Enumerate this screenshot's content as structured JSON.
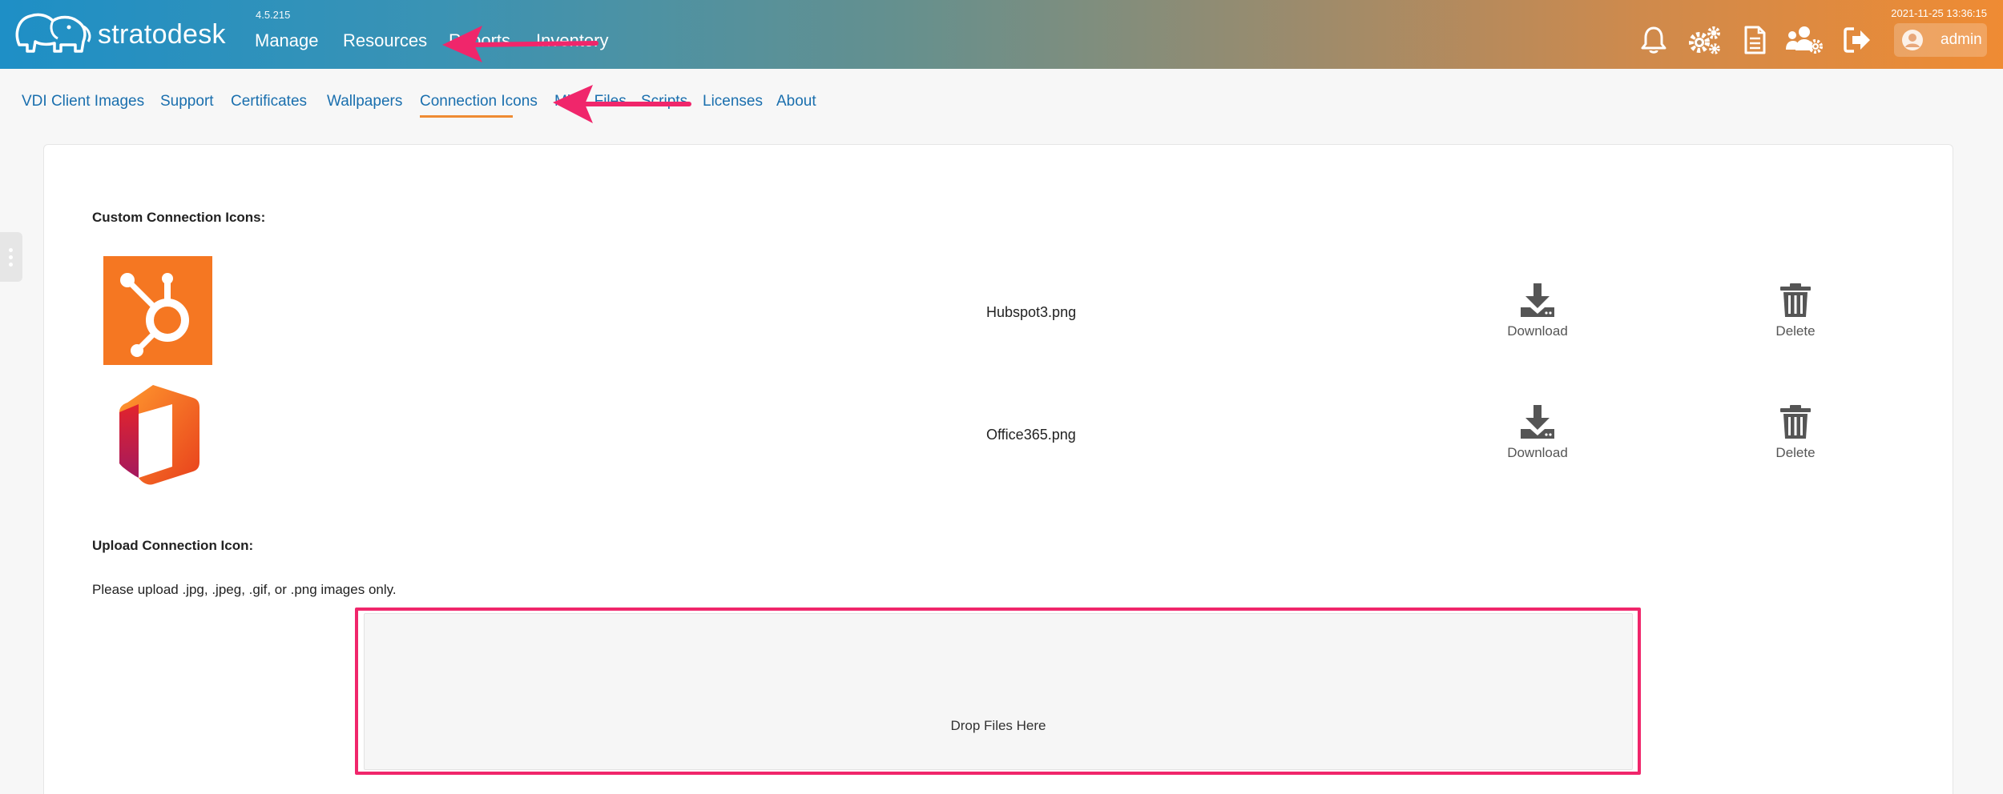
{
  "header": {
    "brand": "stratodesk",
    "version": "4.5.215",
    "nav": [
      {
        "label": "Manage"
      },
      {
        "label": "Resources"
      },
      {
        "label": "Reports"
      },
      {
        "label": "Inventory"
      }
    ],
    "timestamp": "2021-11-25 13:36:15",
    "user": "admin",
    "icons": [
      "bell-icon",
      "gears-icon",
      "document-icon",
      "users-gear-icon",
      "logout-icon"
    ]
  },
  "subnav": {
    "items": [
      {
        "label": "VDI Client Images"
      },
      {
        "label": "Support"
      },
      {
        "label": "Certificates"
      },
      {
        "label": "Wallpapers"
      },
      {
        "label": "Connection Icons"
      },
      {
        "label": "Misc. Files"
      },
      {
        "label": "Scripts"
      },
      {
        "label": "Licenses"
      },
      {
        "label": "About"
      }
    ],
    "active": "Connection Icons"
  },
  "content": {
    "custom_label": "Custom Connection Icons:",
    "icons": [
      {
        "filename": "Hubspot3.png",
        "download_label": "Download",
        "delete_label": "Delete"
      },
      {
        "filename": "Office365.png",
        "download_label": "Download",
        "delete_label": "Delete"
      }
    ],
    "upload_label": "Upload Connection Icon:",
    "upload_help": "Please upload .jpg, .jpeg, .gif, or .png images only.",
    "dropzone_text": "Drop Files Here"
  },
  "colors": {
    "accent": "#ef8b33",
    "link": "#1a6fae",
    "highlight": "#f0266b",
    "hubspot": "#f57722"
  }
}
